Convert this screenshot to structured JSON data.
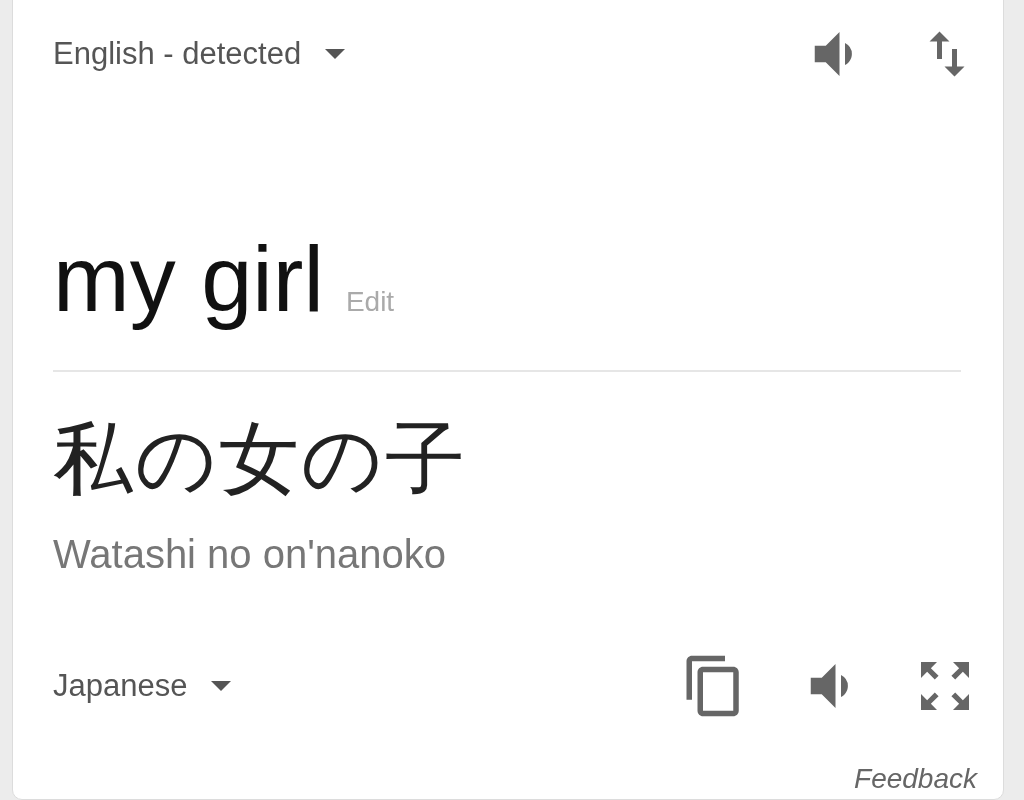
{
  "source": {
    "language": "English - detected",
    "text": "my girl",
    "edit_label": "Edit"
  },
  "target": {
    "language": "Japanese",
    "text": "私の女の子",
    "romanization": "Watashi no on'nanoko"
  },
  "feedback": "Feedback"
}
